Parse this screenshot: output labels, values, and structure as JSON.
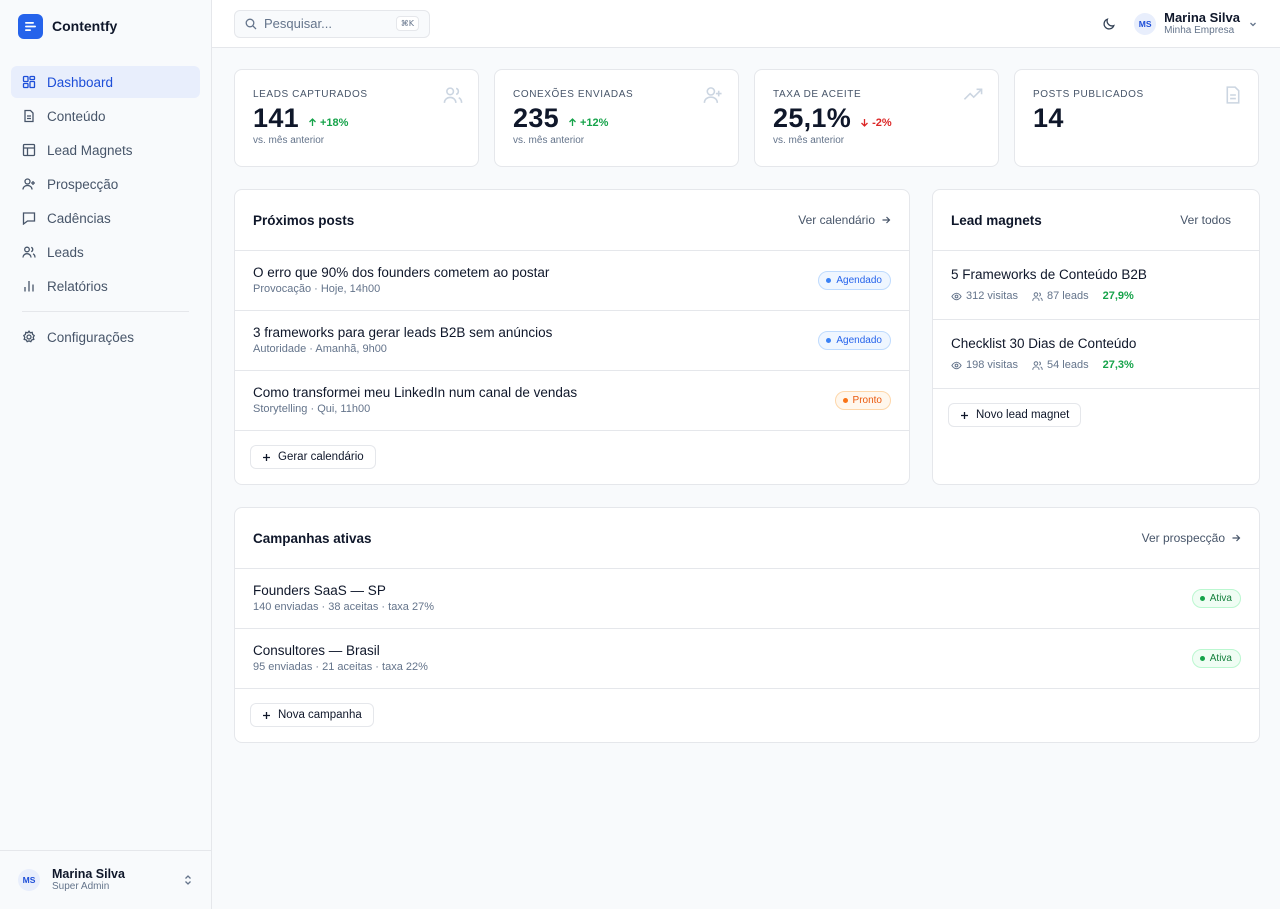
{
  "brand": {
    "name": "Contentfy"
  },
  "sidebar": {
    "items": [
      {
        "label": "Dashboard",
        "icon": "dashboard-icon",
        "active": true
      },
      {
        "label": "Conteúdo",
        "icon": "file-icon"
      },
      {
        "label": "Lead Magnets",
        "icon": "layout-icon"
      },
      {
        "label": "Prospecção",
        "icon": "user-plus-icon"
      },
      {
        "label": "Cadências",
        "icon": "message-icon"
      },
      {
        "label": "Leads",
        "icon": "users-icon"
      },
      {
        "label": "Relatórios",
        "icon": "bar-chart-icon"
      }
    ],
    "settings": {
      "label": "Configurações",
      "icon": "gear-icon"
    },
    "user": {
      "initials": "MS",
      "name": "Marina Silva",
      "role": "Super Admin"
    }
  },
  "topbar": {
    "search_placeholder": "Pesquisar...",
    "shortcut": "⌘K",
    "user": {
      "initials": "MS",
      "name": "Marina Silva",
      "org": "Minha Empresa"
    }
  },
  "stats": [
    {
      "label": "Leads capturados",
      "value": "141",
      "delta": "+18%",
      "direction": "up",
      "sub": "vs. mês anterior",
      "icon": "users-icon"
    },
    {
      "label": "Conexões enviadas",
      "value": "235",
      "delta": "+12%",
      "direction": "up",
      "sub": "vs. mês anterior",
      "icon": "user-plus-icon"
    },
    {
      "label": "Taxa de aceite",
      "value": "25,1%",
      "delta": "-2%",
      "direction": "down",
      "sub": "vs. mês anterior",
      "icon": "trending-up-icon"
    },
    {
      "label": "Posts publicados",
      "value": "14",
      "icon": "document-icon"
    }
  ],
  "posts": {
    "title": "Próximos posts",
    "link": "Ver calendário",
    "items": [
      {
        "title": "O erro que 90% dos founders cometem ao postar",
        "meta": "Provocação · Hoje, 14h00",
        "status": "Agendado",
        "status_type": "scheduled"
      },
      {
        "title": "3 frameworks para gerar leads B2B sem anúncios",
        "meta": "Autoridade · Amanhã, 9h00",
        "status": "Agendado",
        "status_type": "scheduled"
      },
      {
        "title": "Como transformei meu LinkedIn num canal de vendas",
        "meta": "Storytelling · Qui, 11h00",
        "status": "Pronto",
        "status_type": "ready"
      }
    ],
    "button": "Gerar calendário"
  },
  "magnets": {
    "title": "Lead magnets",
    "link": "Ver todos",
    "items": [
      {
        "title": "5 Frameworks de Conteúdo B2B",
        "visits": "312 visitas",
        "leads": "87 leads",
        "conversion": "27,9%"
      },
      {
        "title": "Checklist 30 Dias de Conteúdo",
        "visits": "198 visitas",
        "leads": "54 leads",
        "conversion": "27,3%"
      }
    ],
    "button": "Novo lead magnet"
  },
  "campaigns": {
    "title": "Campanhas ativas",
    "link": "Ver prospecção",
    "items": [
      {
        "title": "Founders SaaS — SP",
        "meta": "140 enviadas · 38 aceitas · taxa 27%",
        "status": "Ativa"
      },
      {
        "title": "Consultores — Brasil",
        "meta": "95 enviadas · 21 aceitas · taxa 22%",
        "status": "Ativa"
      }
    ],
    "button": "Nova campanha"
  },
  "colors": {
    "accent": "#2563eb",
    "success": "#16a34a",
    "danger": "#dc2626",
    "warning": "#ea580c"
  }
}
